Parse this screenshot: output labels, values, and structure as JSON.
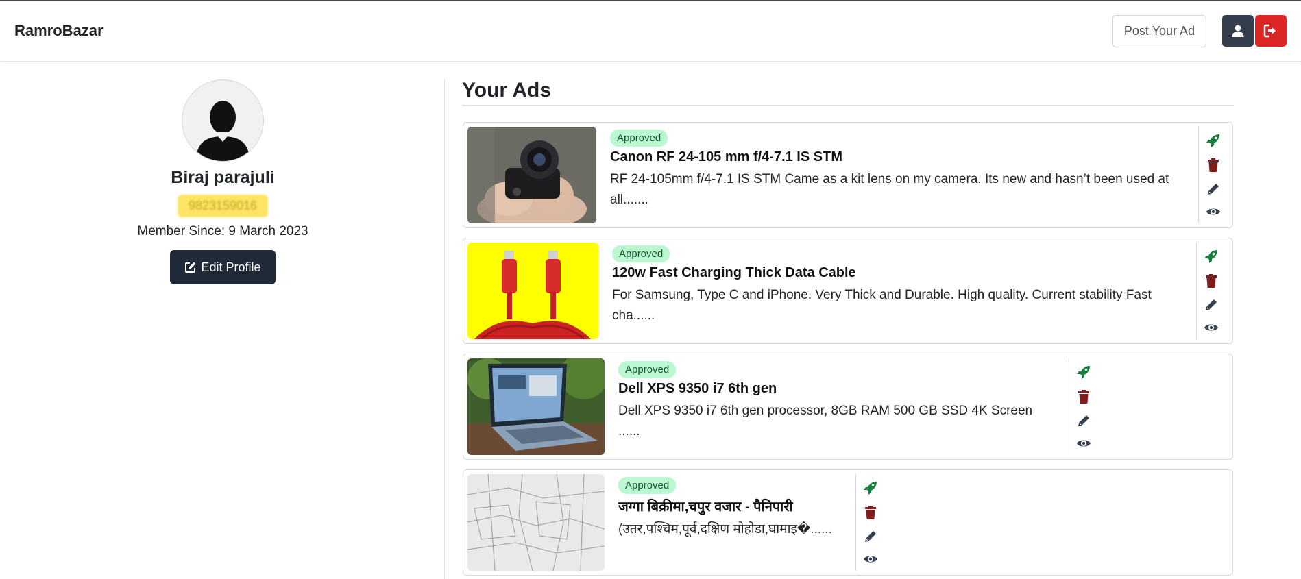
{
  "navbar": {
    "brand": "RamroBazar",
    "post_ad_label": "Post Your Ad",
    "profile_icon": "user-icon",
    "logout_icon": "logout-icon"
  },
  "profile": {
    "name": "Biraj parajuli",
    "phone": "9823159016",
    "member_since": "Member Since: 9 March 2023",
    "edit_label": "Edit Profile"
  },
  "ads": {
    "title": "Your Ads",
    "items": [
      {
        "status": "Approved",
        "title": "Canon RF 24-105 mm f/4-7.1 IS STM",
        "description": "RF 24-105mm f/4-7.1 IS STM Came as a kit lens on my camera. Its new and hasn’t been used at all.......",
        "image": "camera-photo"
      },
      {
        "status": "Approved",
        "title": "120w Fast Charging Thick Data Cable",
        "description": "For Samsung, Type C and iPhone. Very Thick and Durable. High quality. Current stability Fast cha......",
        "image": "cable-photo"
      },
      {
        "status": "Approved",
        "title": "Dell XPS 9350 i7 6th gen",
        "description": "Dell XPS 9350 i7 6th gen processor, 8GB RAM 500 GB SSD 4K Screen ......",
        "image": "laptop-photo"
      },
      {
        "status": "Approved",
        "title": "जग्गा बिक्रीमा,चपुर वजार - पैनिपारी",
        "description": "(उतर,पश्चिम,पूर्व,दक्षिण मोहोडा,घामाइ�......",
        "image": "land-map-photo"
      }
    ]
  },
  "colors": {
    "boost": "#15803d",
    "delete": "#7f1d1d",
    "edit": "#374151",
    "view": "#374151",
    "badge_bg": "#bbf7d0",
    "logout_bg": "#dc2626",
    "dark_btn": "#212a38"
  }
}
